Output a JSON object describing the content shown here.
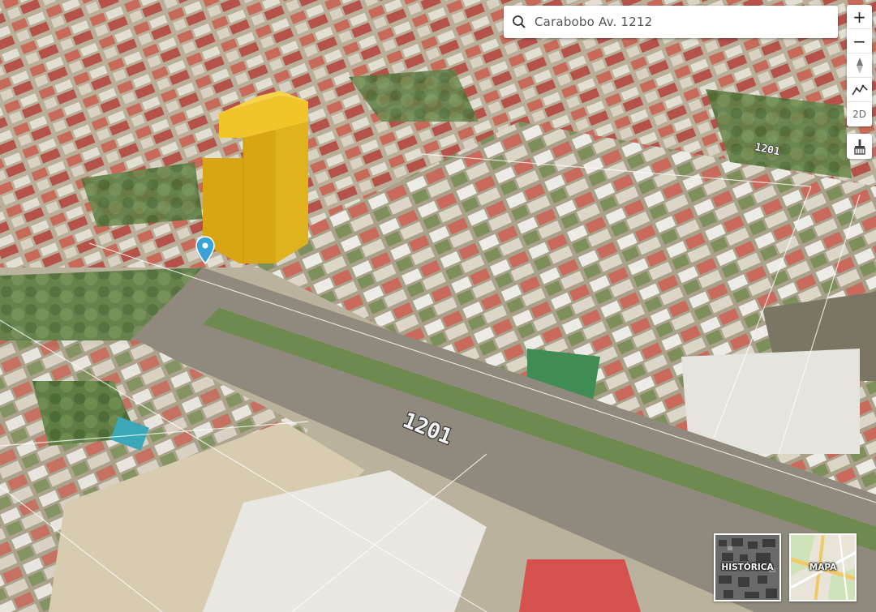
{
  "search": {
    "value": "Carabobo Av. 1212"
  },
  "controls": {
    "zoom_in": "+",
    "zoom_out": "−",
    "view_2d": "2D"
  },
  "map_labels": {
    "street_number_main": "1201",
    "street_number_far": "1201"
  },
  "layers": {
    "historic_label": "HISTÓRICA",
    "map_label": "MAPA"
  },
  "colors": {
    "highlight_building": "#e8b820",
    "marker": "#3aa3d6",
    "roofs_red": "#c8574f"
  },
  "icons": [
    "search-icon",
    "compass-icon",
    "elevation-profile-icon",
    "clear-broom-icon",
    "location-marker-icon"
  ]
}
